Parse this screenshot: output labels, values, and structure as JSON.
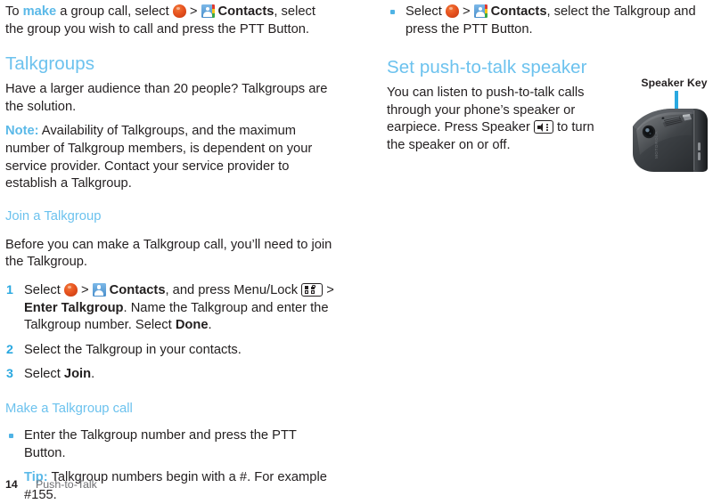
{
  "document": {
    "footer": {
      "page_number": "14",
      "section": "Push-to-Talk"
    }
  },
  "left_column": {
    "intro": {
      "pre": "To ",
      "emphasis": "make",
      "mid": " a group call, select ",
      "icon_menu": "main-menu-icon",
      "sep": " > ",
      "icon_contacts": "contacts-icon",
      "bold_label": "Contacts",
      "post": ", select the group you wish to call and press the PTT Button."
    },
    "heading": "Talkgroups",
    "intro_para": "Have a larger audience than 20 people? Talkgroups are the solution.",
    "note": {
      "label": "Note:",
      "text": " Availability of Talkgroups, and the maximum number of Talkgroup members, is dependent on your service provider. Contact your service provider to establish a Talkgroup."
    },
    "subheading_join": "Join a Talkgroup",
    "join_intro": "Before you can make a Talkgroup call, you’ll need to join the Talkgroup.",
    "steps": [
      {
        "num": "1",
        "pre": "Select ",
        "sep": " > ",
        "bold1": "Contacts",
        "mid": ", and press Menu/Lock ",
        "sep2": " > ",
        "bold2": "Enter Talkgroup",
        "post": ". Name the Talkgroup and enter the Talkgroup number. Select ",
        "bold3": "Done",
        "end": "."
      },
      {
        "num": "2",
        "text": "Select the Talkgroup in your contacts."
      },
      {
        "num": "3",
        "pre": "Select ",
        "bold1": "Join",
        "end": "."
      }
    ],
    "subheading_make": "Make a Talkgroup call",
    "make_bullet": "Enter the Talkgroup number and press the PTT Button.",
    "tip": {
      "label": "Tip:",
      "text": " Talkgroup numbers begin with a #. For example #155."
    }
  },
  "right_column": {
    "bullet": {
      "pre": "Select ",
      "sep": " > ",
      "bold": "Contacts",
      "post": ", select the Talkgroup and press the PTT Button."
    },
    "heading": "Set push-to-talk speaker",
    "body": {
      "pre": "You can listen to push-to-talk calls through your phone’s speaker or earpiece. Press Speaker ",
      "post": " to turn the speaker on or off."
    },
    "figure": {
      "caption": "Speaker Key",
      "device_brand": "MOTOROLA"
    }
  },
  "colors": {
    "heading_blue": "#6cc2ee",
    "accent_blue": "#5bb9e8",
    "list_number_blue": "#29a8e0",
    "body_black": "#231f20",
    "footer_gray": "#6d6e71"
  }
}
